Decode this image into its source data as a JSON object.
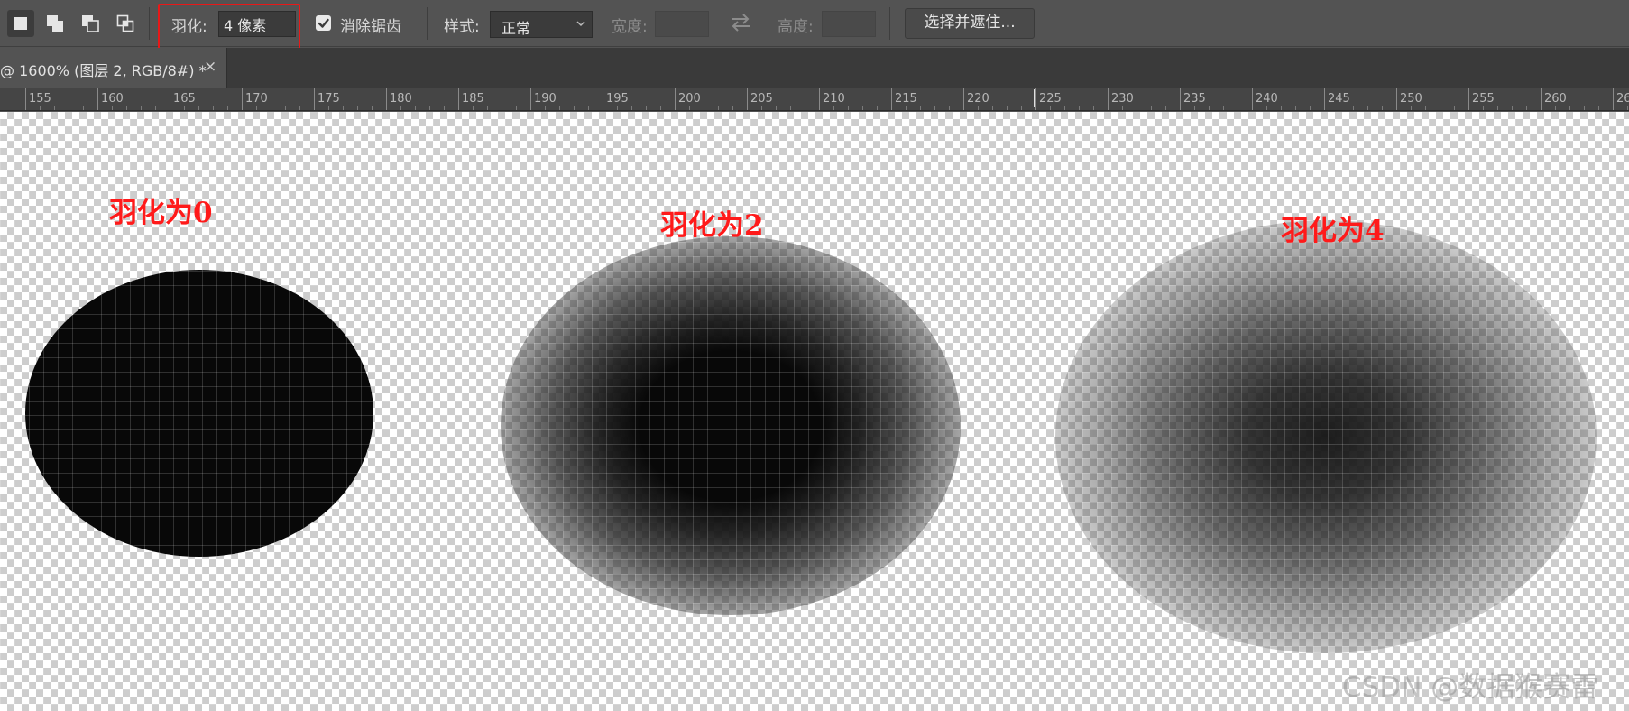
{
  "options_bar": {
    "mode_buttons": [
      {
        "name": "new-selection-icon",
        "active": true
      },
      {
        "name": "add-to-selection-icon",
        "active": false
      },
      {
        "name": "subtract-from-selection-icon",
        "active": false
      },
      {
        "name": "intersect-selection-icon",
        "active": false
      }
    ],
    "feather_label": "羽化:",
    "feather_value": "4 像素",
    "anti_alias_label": "消除锯齿",
    "anti_alias_checked": true,
    "style_label": "样式:",
    "style_value": "正常",
    "width_label": "宽度:",
    "width_value": "",
    "height_label": "高度:",
    "height_value": "",
    "select_and_mask_label": "选择并遮住..."
  },
  "document_tab": {
    "title": "@ 1600% (图层 2, RGB/8#) *",
    "close_label": "×"
  },
  "ruler": {
    "labels": [
      "155",
      "160",
      "165",
      "170",
      "175",
      "180",
      "185",
      "190",
      "195",
      "200",
      "205",
      "210",
      "215",
      "220",
      "225",
      "230",
      "235",
      "240",
      "245",
      "250",
      "255",
      "260",
      "26"
    ]
  },
  "canvas": {
    "annotations": {
      "feather0": "羽化为0",
      "feather2": "羽化为2",
      "feather4": "羽化为4"
    },
    "watermark": "CSDN @数据猴赛雷"
  },
  "colors": {
    "annotation_red": "#ff1a1a",
    "highlight_red": "#e81818",
    "panel_bg": "#535353"
  }
}
